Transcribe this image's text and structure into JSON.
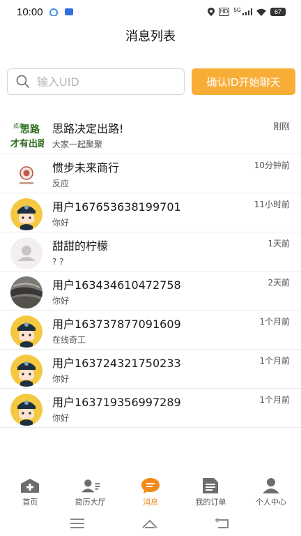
{
  "status_bar": {
    "time": "10:00",
    "hd_label": "HD",
    "network_label": "5G",
    "battery": "67"
  },
  "header": {
    "title": "消息列表"
  },
  "search": {
    "placeholder": "输入UID",
    "value": ""
  },
  "start_chat_button": {
    "label": "确认ID开始聊天"
  },
  "colors": {
    "accent": "#f8ad37",
    "active_nav": "#f08a1b",
    "avatar_yellow": "#f5c842"
  },
  "messages": [
    {
      "name": "思路决定出路!",
      "preview": "大家一起聚聚",
      "time": "刚刚",
      "avatar": "logo-siLu",
      "avatar_text": [
        "成事",
        "思路",
        "才有出路"
      ]
    },
    {
      "name": "惯步未来商行",
      "preview": "反应",
      "time": "10分钟前",
      "avatar": "shop-seal"
    },
    {
      "name": "用户167653638199701",
      "preview": "你好",
      "time": "11小时前",
      "avatar": "cartoon-user"
    },
    {
      "name": "甜甜的柠檬",
      "preview": "? ?",
      "time": "1天前",
      "avatar": "default-user"
    },
    {
      "name": "用户163434610472758",
      "preview": "你好",
      "time": "2天前",
      "avatar": "photo-texture"
    },
    {
      "name": "用户163737877091609",
      "preview": "在线奇工",
      "time": "1个月前",
      "avatar": "cartoon-user"
    },
    {
      "name": "用户163724321750233",
      "preview": "你好",
      "time": "1个月前",
      "avatar": "cartoon-user"
    },
    {
      "name": "用户163719356997289",
      "preview": "你好",
      "time": "1个月前",
      "avatar": "cartoon-user"
    }
  ],
  "bottom_nav": [
    {
      "label": "首页",
      "icon": "home-plus-icon",
      "active": false
    },
    {
      "label": "简历大厅",
      "icon": "resume-icon",
      "active": false
    },
    {
      "label": "消息",
      "icon": "message-icon",
      "active": true
    },
    {
      "label": "我的订单",
      "icon": "order-icon",
      "active": false
    },
    {
      "label": "个人中心",
      "icon": "person-icon",
      "active": false
    }
  ]
}
